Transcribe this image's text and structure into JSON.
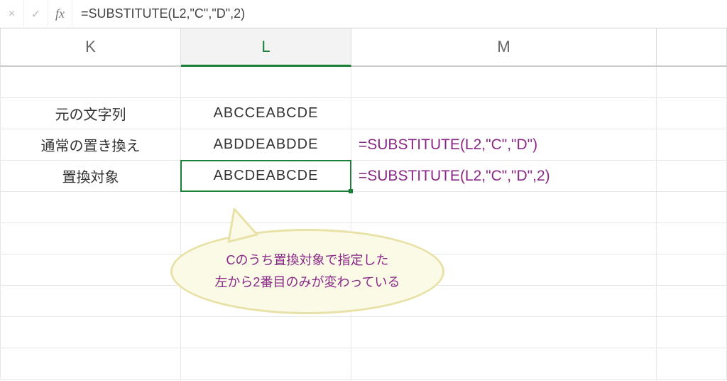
{
  "formula_bar": {
    "cancel": "×",
    "confirm": "✓",
    "fx": "fx",
    "formula": "=SUBSTITUTE(L2,\"C\",\"D\",2)"
  },
  "column_headers": {
    "K": "K",
    "L": "L",
    "M": "M",
    "N": ""
  },
  "rows": [
    {
      "K": "",
      "L": "",
      "M": ""
    },
    {
      "K": "元の文字列",
      "L": "ABCCEABCDE",
      "M": ""
    },
    {
      "K": "通常の置き換え",
      "L": "ABDDEABDDE",
      "M": "=SUBSTITUTE(L2,\"C\",\"D\")"
    },
    {
      "K": "置換対象",
      "L": "ABCDEABCDE",
      "M": "=SUBSTITUTE(L2,\"C\",\"D\",2)"
    },
    {
      "K": "",
      "L": "",
      "M": ""
    },
    {
      "K": "",
      "L": "",
      "M": ""
    },
    {
      "K": "",
      "L": "",
      "M": ""
    },
    {
      "K": "",
      "L": "",
      "M": ""
    },
    {
      "K": "",
      "L": "",
      "M": ""
    },
    {
      "K": "",
      "L": "",
      "M": ""
    }
  ],
  "selected_cell": {
    "row_index": 3,
    "col": "L"
  },
  "active_column": "L",
  "callout": {
    "line1": "Cのうち置換対象で指定した",
    "line2": "左から2番目のみが変わっている"
  }
}
